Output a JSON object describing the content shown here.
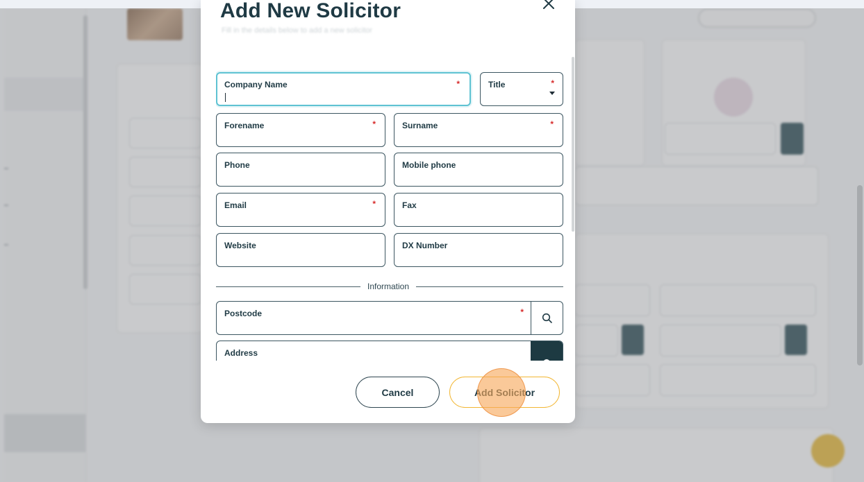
{
  "modal": {
    "title": "Add New Solicitor",
    "subtitle": "Fill in the details below to add a new solicitor"
  },
  "form": {
    "company_name": {
      "label": "Company Name",
      "required_mark": "*",
      "value": ""
    },
    "title": {
      "label": "Title",
      "required_mark": "*",
      "value": ""
    },
    "forename": {
      "label": "Forename",
      "required_mark": "*",
      "value": ""
    },
    "surname": {
      "label": "Surname",
      "required_mark": "*",
      "value": ""
    },
    "phone": {
      "label": "Phone",
      "value": ""
    },
    "mobile_phone": {
      "label": "Mobile phone",
      "value": ""
    },
    "email": {
      "label": "Email",
      "required_mark": "*",
      "value": ""
    },
    "fax": {
      "label": "Fax",
      "value": ""
    },
    "website": {
      "label": "Website",
      "value": ""
    },
    "dx_number": {
      "label": "DX Number",
      "value": ""
    },
    "section_information": "Information",
    "postcode": {
      "label": "Postcode",
      "required_mark": "*",
      "value": ""
    },
    "address": {
      "label": "Address",
      "value": ""
    }
  },
  "actions": {
    "cancel": "Cancel",
    "add": "Add Solicitor"
  },
  "colors": {
    "focus_border": "#5ec2d2",
    "primary_dark": "#1d3a42",
    "accent_yellow": "#f2b632",
    "required_red": "#d72c2c",
    "click_indicator": "#f7a85a"
  },
  "icons": {
    "close": "close-icon",
    "search": "search-icon",
    "address_action": "location-icon",
    "dropdown": "chevron-down-icon"
  }
}
